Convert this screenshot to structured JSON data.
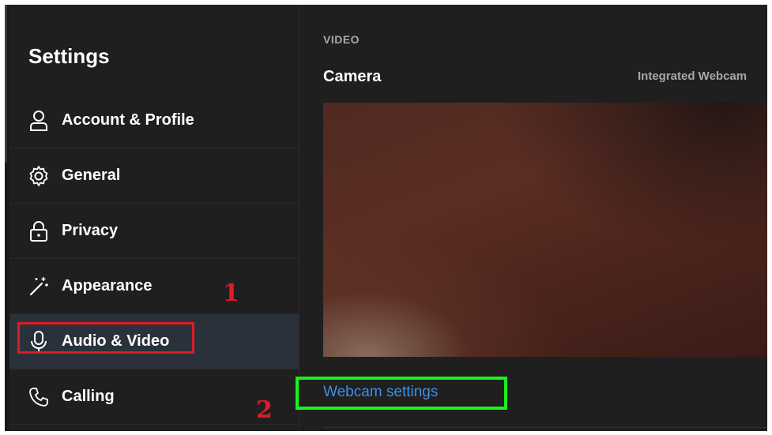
{
  "sidebar": {
    "title": "Settings",
    "items": [
      {
        "label": "Account & Profile",
        "icon": "person-icon"
      },
      {
        "label": "General",
        "icon": "gear-icon"
      },
      {
        "label": "Privacy",
        "icon": "lock-icon"
      },
      {
        "label": "Appearance",
        "icon": "magic-wand-icon"
      },
      {
        "label": "Audio & Video",
        "icon": "microphone-icon",
        "active": true
      },
      {
        "label": "Calling",
        "icon": "phone-icon"
      }
    ]
  },
  "annotations": {
    "marker_1": "1",
    "marker_2": "2",
    "highlight_red": "#e01b24",
    "highlight_green": "#18f31a"
  },
  "content": {
    "section_label": "VIDEO",
    "camera_label": "Camera",
    "camera_value": "Integrated Webcam",
    "webcam_settings_link": "Webcam settings"
  },
  "colors": {
    "background": "#1f1f1f",
    "active_item": "#2b313a",
    "link": "#3d8fe6"
  }
}
